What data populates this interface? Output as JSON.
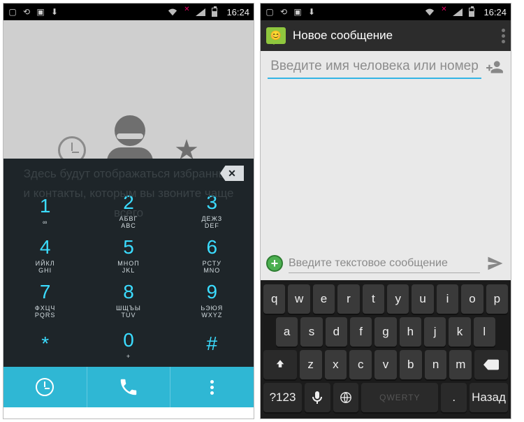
{
  "statusbar": {
    "time": "16:24"
  },
  "dialer": {
    "ghost_line1": "Здесь будут отображаться избранные",
    "ghost_line2": "и контакты, которым вы звоните чаще",
    "ghost_line3": "всего",
    "keys": [
      {
        "digit": "1",
        "sub": "∞"
      },
      {
        "digit": "2",
        "sub": "АБВГ\nABC"
      },
      {
        "digit": "3",
        "sub": "ДЕЖЗ\nDEF"
      },
      {
        "digit": "4",
        "sub": "ИЙКЛ\nGHI"
      },
      {
        "digit": "5",
        "sub": "МНОП\nJKL"
      },
      {
        "digit": "6",
        "sub": "РСТУ\nMNO"
      },
      {
        "digit": "7",
        "sub": "ФХЦЧ\nPQRS"
      },
      {
        "digit": "8",
        "sub": "ШЩЪЫ\nTUV"
      },
      {
        "digit": "9",
        "sub": "ЬЭЮЯ\nWXYZ"
      },
      {
        "digit": "*",
        "sub": ""
      },
      {
        "digit": "0",
        "sub": "+"
      },
      {
        "digit": "#",
        "sub": ""
      }
    ]
  },
  "messaging": {
    "title": "Новое сообщение",
    "recipient_placeholder": "Введите имя человека или номер",
    "compose_placeholder": "Введите текстовое сообщение"
  },
  "keyboard": {
    "row1": [
      "q",
      "w",
      "e",
      "r",
      "t",
      "y",
      "u",
      "i",
      "o",
      "p"
    ],
    "row2": [
      "a",
      "s",
      "d",
      "f",
      "g",
      "h",
      "j",
      "k",
      "l"
    ],
    "row3": [
      "z",
      "x",
      "c",
      "v",
      "b",
      "n",
      "m"
    ],
    "sym": "?123",
    "space": "QWERTY",
    "period": ".",
    "back": "Назад"
  }
}
